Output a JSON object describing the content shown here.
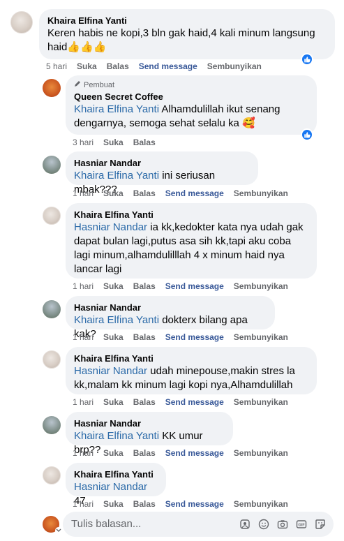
{
  "comments": [
    {
      "author": "Khaira Elfina Yanti",
      "text": "Keren habis ne kopi,3 bln gak haid,4 kali minum langsung haid",
      "emoji": "👍👍👍",
      "time": "5 hari",
      "like": "Suka",
      "reply": "Balas",
      "send": "Send message",
      "hide": "Sembunyikan"
    },
    {
      "author_tag": "Pembuat",
      "author": "Queen Secret Coffee",
      "mention": "Khaira Elfina Yanti",
      "text": " Alhamdulillah ikut senang dengarnya, semoga sehat selalu ka ",
      "emoji": "🥰",
      "time": "3 hari",
      "like": "Suka",
      "reply": "Balas"
    },
    {
      "author": "Hasniar Nandar",
      "mention": "Khaira Elfina Yanti",
      "text": " ini seriusan mbak???",
      "time": "1 hari",
      "like": "Suka",
      "reply": "Balas",
      "send": "Send message",
      "hide": "Sembunyikan"
    },
    {
      "author": "Khaira Elfina Yanti",
      "mention": "Hasniar Nandar",
      "text": " ia kk,kedokter kata nya udah gak dapat bulan lagi,putus asa sih kk,tapi aku coba lagi minum,alhamdulilllah 4 x minum haid nya lancar lagi",
      "time": "1 hari",
      "like": "Suka",
      "reply": "Balas",
      "send": "Send message",
      "hide": "Sembunyikan"
    },
    {
      "author": "Hasniar Nandar",
      "mention": "Khaira Elfina Yanti",
      "text": " dokterx bilang apa kak?",
      "time": "1 hari",
      "like": "Suka",
      "reply": "Balas",
      "send": "Send message",
      "hide": "Sembunyikan"
    },
    {
      "author": "Khaira Elfina Yanti",
      "mention": "Hasniar Nandar",
      "text": " udah minepouse,makin stres la kk,malam kk minum lagi kopi nya,Alhamdulillah",
      "time": "1 hari",
      "like": "Suka",
      "reply": "Balas",
      "send": "Send message",
      "hide": "Sembunyikan"
    },
    {
      "author": "Hasniar Nandar",
      "mention": "Khaira Elfina Yanti",
      "text": " KK umur brp??",
      "time": "1 hari",
      "like": "Suka",
      "reply": "Balas",
      "send": "Send message",
      "hide": "Sembunyikan"
    },
    {
      "author": "Khaira Elfina Yanti",
      "mention": "Hasniar Nandar",
      "text": " 47",
      "time": "1 hari",
      "like": "Suka",
      "reply": "Balas",
      "send": "Send message",
      "hide": "Sembunyikan"
    }
  ],
  "reply_box": {
    "placeholder": "Tulis balasan...",
    "icons": [
      "sticker-avatar-icon",
      "emoji-icon",
      "camera-icon",
      "gif-icon",
      "sticker-icon"
    ]
  },
  "colors": {
    "bubble": "#f0f2f5",
    "mention": "#2b6aa8",
    "meta": "#65676b",
    "like_badge": "#1877f2"
  }
}
